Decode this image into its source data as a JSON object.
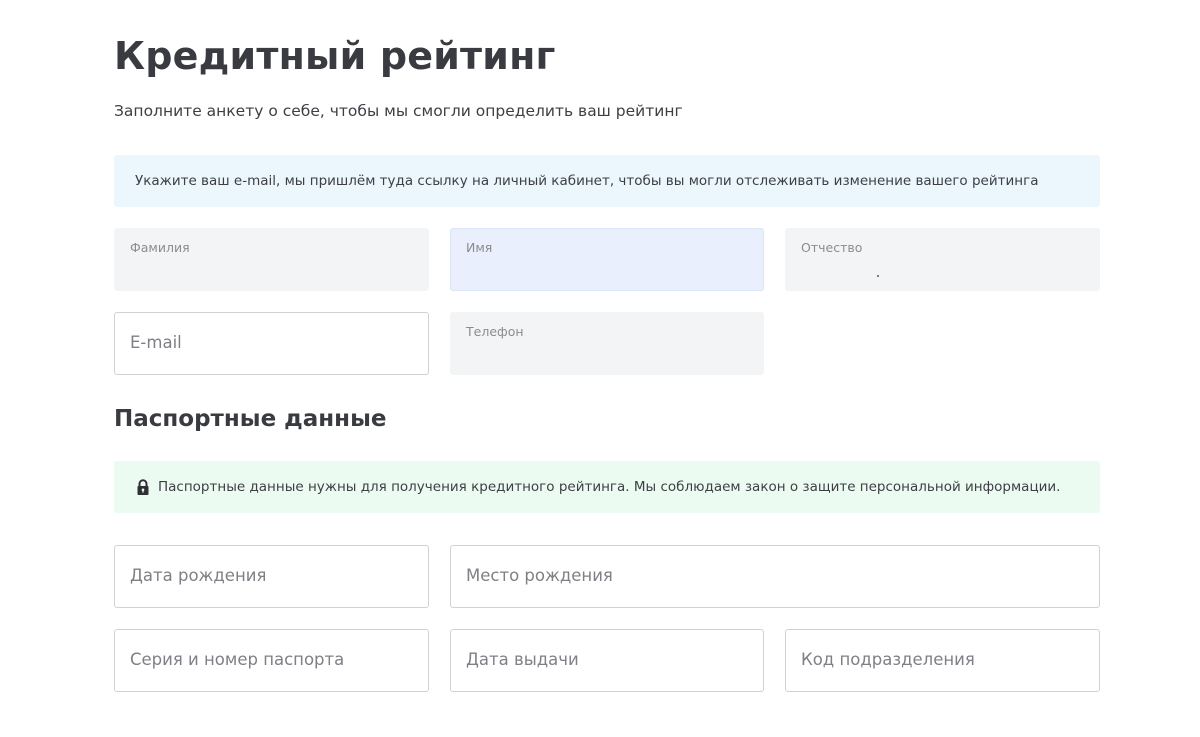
{
  "header": {
    "title": "Кредитный рейтинг",
    "subtitle": "Заполните анкету о себе, чтобы мы смогли определить ваш рейтинг"
  },
  "email_notice": {
    "text": "Укажите ваш e-mail, мы пришлём туда ссылку на личный кабинет, чтобы вы могли отслеживать изменение вашего рейтинга"
  },
  "personal": {
    "last_name": {
      "label": "Фамилия",
      "value": ""
    },
    "first_name": {
      "label": "Имя",
      "value": ""
    },
    "patronymic": {
      "label": "Отчество",
      "value": ""
    },
    "email": {
      "placeholder": "E-mail"
    },
    "phone": {
      "label": "Телефон",
      "value": ""
    }
  },
  "passport": {
    "section_title": "Паспортные данные",
    "notice": "Паспортные данные нужны для получения кредитного рейтинга. Мы соблюдаем закон о защите персональной информации.",
    "notice_icon": "lock-icon",
    "birth_date": {
      "placeholder": "Дата рождения"
    },
    "birth_place": {
      "placeholder": "Место рождения"
    },
    "series_number": {
      "placeholder": "Серия и номер паспорта"
    },
    "issue_date": {
      "placeholder": "Дата выдачи"
    },
    "division_code": {
      "placeholder": "Код подразделения"
    }
  },
  "colors": {
    "info_blue": "#ebf6fd",
    "info_green": "#ebfbf1",
    "field_filled": "#f3f4f5",
    "field_focused": "#e9effc",
    "text": "#3d3f45"
  }
}
